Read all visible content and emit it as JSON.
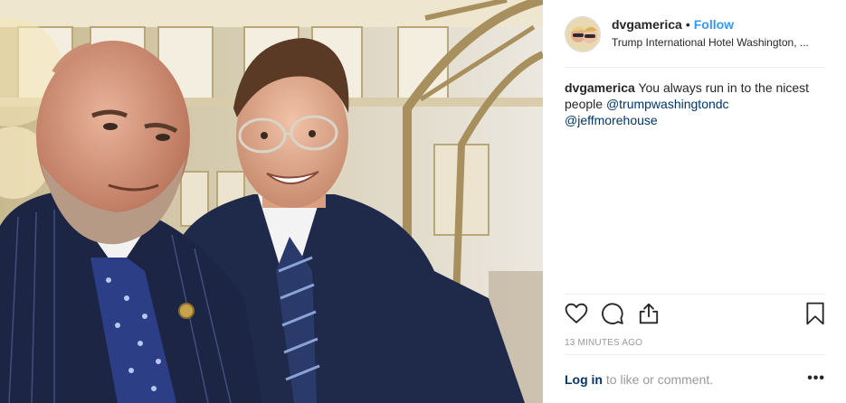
{
  "header": {
    "username": "dvgamerica",
    "separator": "•",
    "follow_label": "Follow",
    "location": "Trump International Hotel Washington, ..."
  },
  "caption": {
    "username": "dvgamerica",
    "text": "You always run in to the nicest people",
    "mentions": [
      "@trumpwashingtondc",
      "@jeffmorehouse"
    ]
  },
  "actions": {
    "like_icon": "heart-icon",
    "comment_icon": "comment-icon",
    "share_icon": "share-icon",
    "save_icon": "bookmark-icon"
  },
  "timestamp": "13 MINUTES AGO",
  "login": {
    "link_label": "Log in",
    "rest_text": "to like or comment.",
    "more_label": "•••"
  },
  "colors": {
    "link_blue": "#3897f0",
    "mention_blue": "#003569",
    "muted": "#999999",
    "divider": "#efefef"
  }
}
